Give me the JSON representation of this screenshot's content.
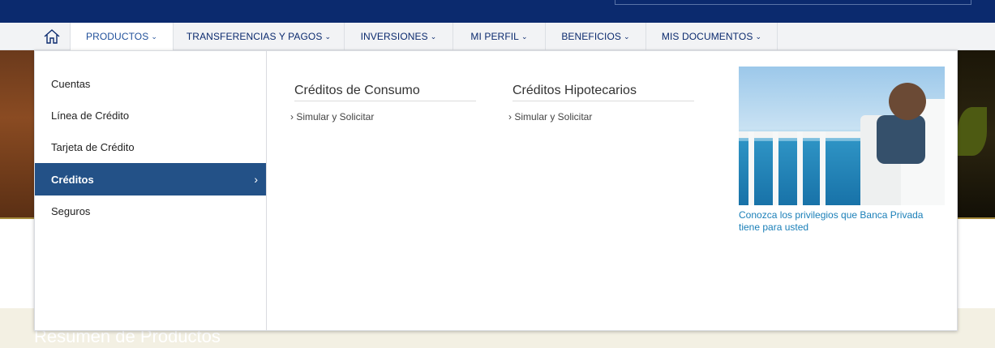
{
  "nav": {
    "home_icon": "home-icon",
    "items": [
      {
        "label": "PRODUCTOS"
      },
      {
        "label": "TRANSFERENCIAS Y PAGOS"
      },
      {
        "label": "INVERSIONES"
      },
      {
        "label": "MI PERFIL"
      },
      {
        "label": "BENEFICIOS"
      },
      {
        "label": "MIS DOCUMENTOS"
      }
    ],
    "chevron": "⌄"
  },
  "menu": {
    "categories": [
      {
        "label": "Cuentas"
      },
      {
        "label": "Línea de Crédito"
      },
      {
        "label": "Tarjeta de Crédito"
      },
      {
        "label": "Créditos"
      },
      {
        "label": "Seguros"
      }
    ],
    "active_arrow": "›",
    "columns": [
      {
        "title": "Créditos de Consumo",
        "link": "› Simular y Solicitar"
      },
      {
        "title": "Créditos Hipotecarios",
        "link": "› Simular y Solicitar"
      }
    ],
    "promo_text": "Conozca los privilegios que Banca Privada tiene para usted"
  },
  "page": {
    "section_title": "Resumen de Productos"
  },
  "colors": {
    "brand_navy": "#0b2a6e",
    "active_blue": "#235187",
    "link_blue": "#1a7fb8"
  }
}
